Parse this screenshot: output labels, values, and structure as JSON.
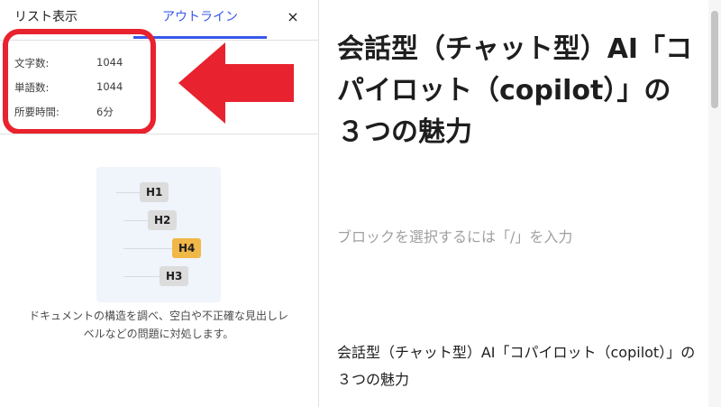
{
  "sidebar": {
    "tabs": [
      {
        "label": "リスト表示",
        "active": false
      },
      {
        "label": "アウトライン",
        "active": true
      }
    ],
    "close_icon": "×",
    "stats": [
      {
        "label": "文字数:",
        "value": "1044"
      },
      {
        "label": "単語数:",
        "value": "1044"
      },
      {
        "label": "所要時間:",
        "value": "6分"
      }
    ],
    "outline_illustration": {
      "headings": [
        "H1",
        "H2",
        "H4",
        "H3"
      ],
      "highlighted": "H4"
    },
    "description": "ドキュメントの構造を調べ、空白や不正確な見出しレベルなどの問題に対処します。"
  },
  "editor": {
    "title": "会話型（チャット型）AI「コパイロット（copilot）」の３つの魅力",
    "block_placeholder": "ブロックを選択するには「/」を入力",
    "paragraph": "会話型（チャット型）AI「コパイロット（copilot）」の３つの魅力"
  },
  "annotation": {
    "color": "#e8222e",
    "icon": "arrow-left-icon"
  },
  "colors": {
    "accent": "#3858e9",
    "highlight": "#f0b849"
  }
}
